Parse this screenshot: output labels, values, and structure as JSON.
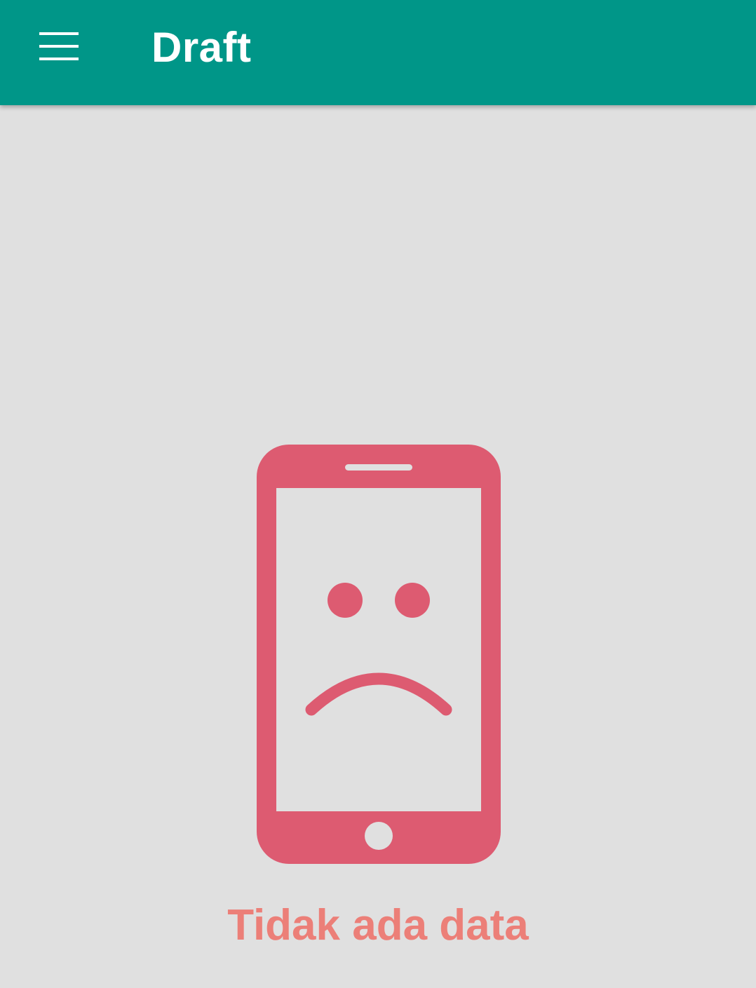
{
  "app_bar": {
    "title": "Draft",
    "menu_icon": "hamburger-menu-icon",
    "background_color": "#009688",
    "text_color": "#ffffff"
  },
  "empty_state": {
    "icon": "sad-phone-icon",
    "icon_color": "#dd5b71",
    "message": "Tidak ada data",
    "message_color": "#ec7f78"
  },
  "background_color": "#e0e0e0"
}
